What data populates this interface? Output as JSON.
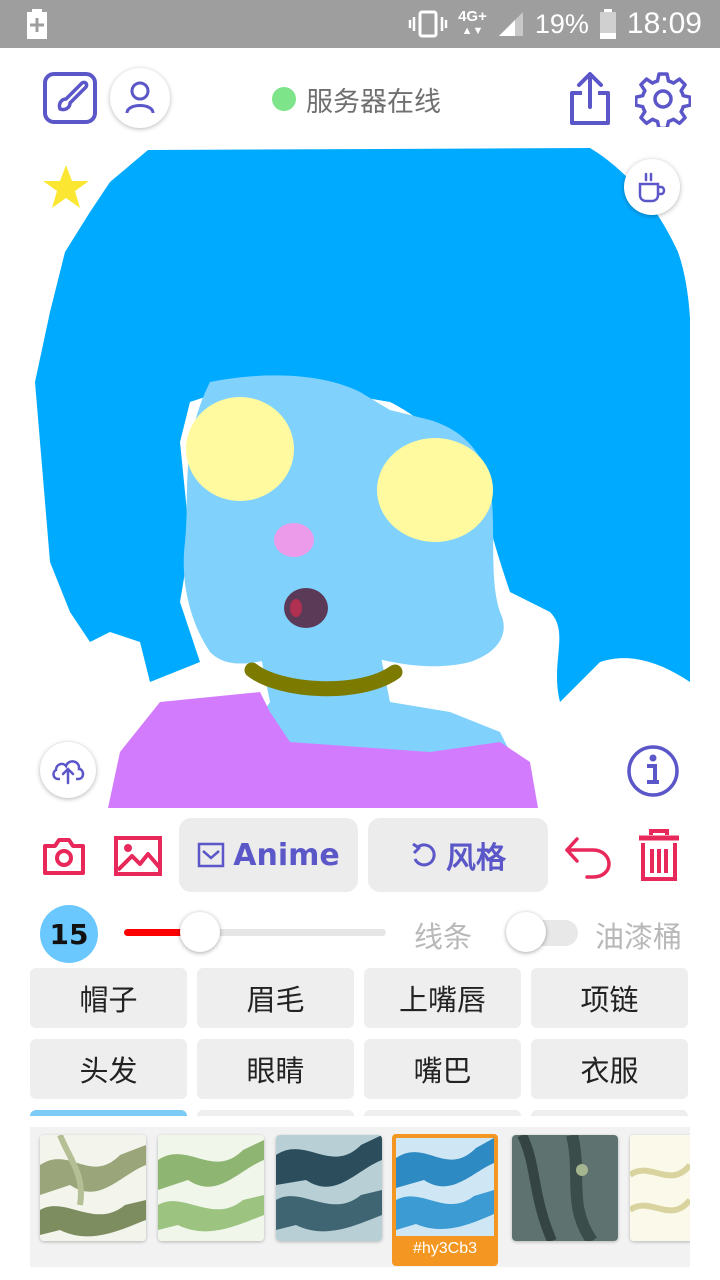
{
  "status_bar": {
    "network": "4G+",
    "battery_percent": "19%",
    "time": "18:09"
  },
  "header": {
    "server_status_text": "服务器在线",
    "server_status_color": "#7de48a",
    "left_icons": [
      "brush-square-icon",
      "user-icon"
    ],
    "right_icons": [
      "share-icon",
      "gear-icon"
    ]
  },
  "canvas": {
    "overlay_icons": [
      "star-icon",
      "coffee-cup-icon",
      "cloud-upload-icon",
      "info-icon"
    ],
    "colors": {
      "hair": "#00aaff",
      "skin": "#80d2fc",
      "eyes": "#fffaa0",
      "blush": "#ec9bea",
      "mouth": "#5a3a56",
      "necklace": "#7d7a00",
      "clothes": "#d27cfd"
    }
  },
  "toolbar": {
    "camera_icon": "camera-icon",
    "gallery_icon": "image-icon",
    "anime_label": "Anime",
    "style_label": "风格",
    "undo_icon": "undo-icon",
    "delete_icon": "trash-icon",
    "accent_color": "#e8285a",
    "button_text_color": "#5b57c8"
  },
  "brush": {
    "size": "15",
    "slider_fraction": 0.29,
    "line_label": "线条",
    "bucket_label": "油漆桶",
    "bucket_enabled": false
  },
  "categories": {
    "row1": [
      "帽子",
      "眉毛",
      "上嘴唇",
      "项链"
    ],
    "row2": [
      "头发",
      "眼睛",
      "嘴巴",
      "衣服"
    ]
  },
  "styles": {
    "selected_label": "#hy3Cb3",
    "selected_color": "#f39722"
  }
}
